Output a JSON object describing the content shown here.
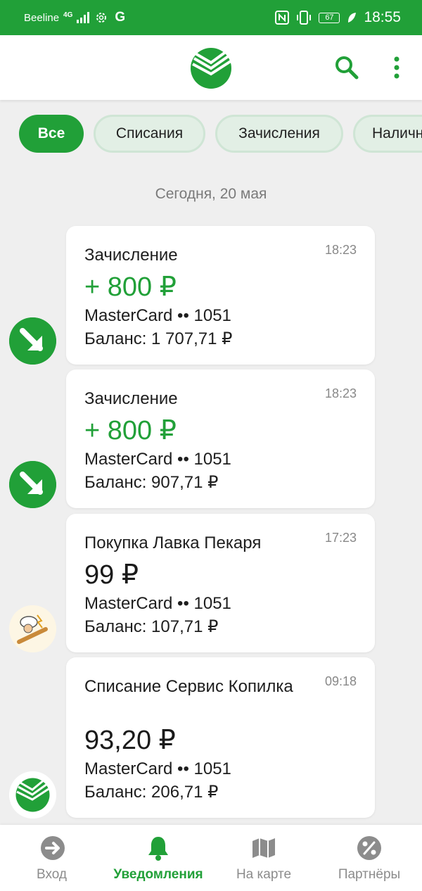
{
  "status_bar": {
    "carrier": "Beeline",
    "network": "4G",
    "g_icon": "G",
    "battery": "67",
    "time": "18:55"
  },
  "header": {
    "logo": "sber-logo-icon",
    "search_icon": "search-icon",
    "menu_icon": "more-vertical-icon"
  },
  "filters": [
    {
      "label": "Все",
      "active": true
    },
    {
      "label": "Списания",
      "active": false
    },
    {
      "label": "Зачисления",
      "active": false
    },
    {
      "label": "Наличные",
      "active": false
    }
  ],
  "date_label": "Сегодня, 20 мая",
  "notifications": [
    {
      "title": "Зачисление",
      "time": "18:23",
      "amount": "+ 800 ₽",
      "card": "MasterCard •• 1051",
      "balance": "Баланс: 1 707,71 ₽",
      "icon": "arrow-down-right-icon"
    },
    {
      "title": "Зачисление",
      "time": "18:23",
      "amount": "+ 800 ₽",
      "card": "MasterCard •• 1051",
      "balance": "Баланс: 907,71 ₽",
      "icon": "arrow-down-right-icon"
    },
    {
      "title": "Покупка Лавка Пекаря",
      "time": "17:23",
      "amount": "99 ₽",
      "card": "MasterCard •• 1051",
      "balance": "Баланс: 107,71 ₽",
      "icon": "bakery-chef-icon"
    },
    {
      "title": "Списание Сервис Копилка",
      "time": "09:18",
      "amount": "93,20 ₽",
      "card": "MasterCard •• 1051",
      "balance": "Баланс: 206,71 ₽",
      "icon": "sber-logo-icon"
    }
  ],
  "bottom_nav": [
    {
      "label": "Вход",
      "icon": "login-arrow-icon",
      "active": false
    },
    {
      "label": "Уведомления",
      "icon": "bell-icon",
      "active": true
    },
    {
      "label": "На карте",
      "icon": "map-icon",
      "active": false
    },
    {
      "label": "Партнёры",
      "icon": "percent-icon",
      "active": false
    }
  ],
  "colors": {
    "brand": "#21a038",
    "chip_bg": "#e2efe5",
    "background": "#efefef"
  }
}
